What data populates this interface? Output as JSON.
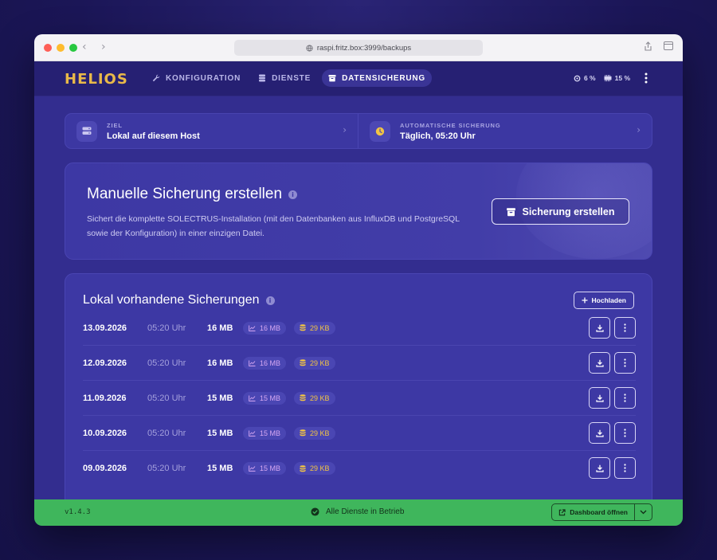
{
  "browser": {
    "url": "raspi.fritz.box:3999/backups",
    "back_icon": "chevron-left-icon",
    "forward_icon": "chevron-right-icon"
  },
  "app": {
    "logo": "HELIOS",
    "nav": [
      {
        "label": "KONFIGURATION",
        "icon": "wrench-icon",
        "active": false
      },
      {
        "label": "DIENSTE",
        "icon": "database-icon",
        "active": false
      },
      {
        "label": "DATENSICHERUNG",
        "icon": "archive-icon",
        "active": true
      }
    ],
    "stats": {
      "cpu": "6 %",
      "memory": "15 %"
    }
  },
  "target": {
    "label": "ZIEL",
    "value": "Lokal auf diesem Host"
  },
  "schedule": {
    "label": "AUTOMATISCHE SICHERUNG",
    "value": "Täglich, 05:20 Uhr"
  },
  "manual": {
    "title": "Manuelle Sicherung erstellen",
    "description": "Sichert die komplette SOLECTRUS-Installation (mit den Datenbanken aus InfluxDB und PostgreSQL sowie der Konfiguration) in einer einzigen Datei.",
    "button": "Sicherung erstellen"
  },
  "backups": {
    "title": "Lokal vorhandene Sicherungen",
    "upload": "Hochladen",
    "rows": [
      {
        "date": "13.09.2026",
        "time": "05:20 Uhr",
        "size": "16 MB",
        "influx": "16 MB",
        "postgres": "29 KB"
      },
      {
        "date": "12.09.2026",
        "time": "05:20 Uhr",
        "size": "16 MB",
        "influx": "16 MB",
        "postgres": "29 KB"
      },
      {
        "date": "11.09.2026",
        "time": "05:20 Uhr",
        "size": "15 MB",
        "influx": "15 MB",
        "postgres": "29 KB"
      },
      {
        "date": "10.09.2026",
        "time": "05:20 Uhr",
        "size": "15 MB",
        "influx": "15 MB",
        "postgres": "29 KB"
      },
      {
        "date": "09.09.2026",
        "time": "05:20 Uhr",
        "size": "15 MB",
        "influx": "15 MB",
        "postgres": "29 KB"
      }
    ]
  },
  "footer": {
    "version": "v1.4.3",
    "status": "Alle Dienste in Betrieb",
    "dashboard": "Dashboard öffnen"
  },
  "colors": {
    "accent": "#e9b949",
    "content_bg": "#332d8f",
    "footer_bg": "#3fb65c"
  }
}
